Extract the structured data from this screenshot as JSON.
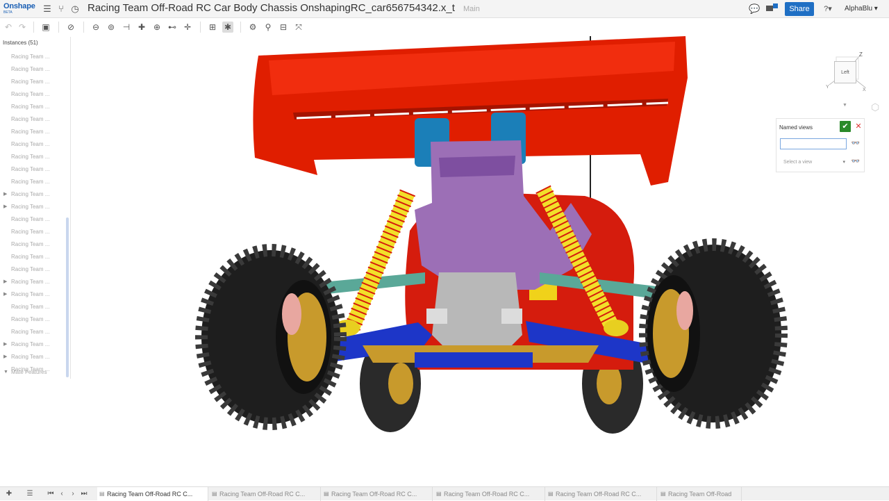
{
  "header": {
    "logo_text": "Onshape",
    "logo_beta": "BETA",
    "document_title": "Racing Team Off-Road RC Car Body Chassis OnshapingRC_car656754342.x_t",
    "branch": "Main",
    "share_label": "Share",
    "notification_count": "1",
    "user_name": "AlphaBlu ▾",
    "help_label": "?▾"
  },
  "instances_panel": {
    "header": "Instances (51)",
    "items": [
      {
        "label": "Racing Team ...",
        "expandable": false
      },
      {
        "label": "Racing Team ...",
        "expandable": false
      },
      {
        "label": "Racing Team ...",
        "expandable": false
      },
      {
        "label": "Racing Team ...",
        "expandable": false
      },
      {
        "label": "Racing Team ...",
        "expandable": false
      },
      {
        "label": "Racing Team ...",
        "expandable": false
      },
      {
        "label": "Racing Team ...",
        "expandable": false
      },
      {
        "label": "Racing Team ...",
        "expandable": false
      },
      {
        "label": "Racing Team ...",
        "expandable": false
      },
      {
        "label": "Racing Team ...",
        "expandable": false
      },
      {
        "label": "Racing Team ...",
        "expandable": false
      },
      {
        "label": "Racing Team ...",
        "expandable": true
      },
      {
        "label": "Racing Team ...",
        "expandable": true
      },
      {
        "label": "Racing Team ...",
        "expandable": false
      },
      {
        "label": "Racing Team ...",
        "expandable": false
      },
      {
        "label": "Racing Team ...",
        "expandable": false
      },
      {
        "label": "Racing Team ...",
        "expandable": false
      },
      {
        "label": "Racing Team ...",
        "expandable": false
      },
      {
        "label": "Racing Team ...",
        "expandable": true
      },
      {
        "label": "Racing Team ...",
        "expandable": true
      },
      {
        "label": "Racing Team ...",
        "expandable": false
      },
      {
        "label": "Racing Team ...",
        "expandable": false
      },
      {
        "label": "Racing Team ...",
        "expandable": false
      },
      {
        "label": "Racing Team ...",
        "expandable": true
      },
      {
        "label": "Racing Team ...",
        "expandable": true
      },
      {
        "label": "Racing Team ...",
        "expandable": false
      }
    ],
    "mate_features_label": "Mate Features"
  },
  "viewcube": {
    "face_label": "Left",
    "axis_z": "Z",
    "axis_y": "Y",
    "axis_x": "X"
  },
  "named_views": {
    "title": "Named views",
    "input_value": "",
    "select_placeholder": "Select a view"
  },
  "tabs": [
    {
      "label": "Racing Team Off-Road RC C...",
      "active": true
    },
    {
      "label": "Racing Team Off-Road RC C...",
      "active": false
    },
    {
      "label": "Racing Team Off-Road RC C...",
      "active": false
    },
    {
      "label": "Racing Team Off-Road RC C...",
      "active": false
    },
    {
      "label": "Racing Team Off-Road RC C...",
      "active": false
    },
    {
      "label": "Racing Team Off-Road",
      "active": false
    }
  ],
  "colors": {
    "brand": "#1a5fb4",
    "share": "#1f6fc4",
    "wing": "#e01e00",
    "purple_bracket": "#9c6fb6",
    "blue_arm": "#1d36c8",
    "tire": "#1e1e1e",
    "rim": "#c89a2c",
    "spring": "#f2e02a",
    "teal_rod": "#5aa898"
  }
}
